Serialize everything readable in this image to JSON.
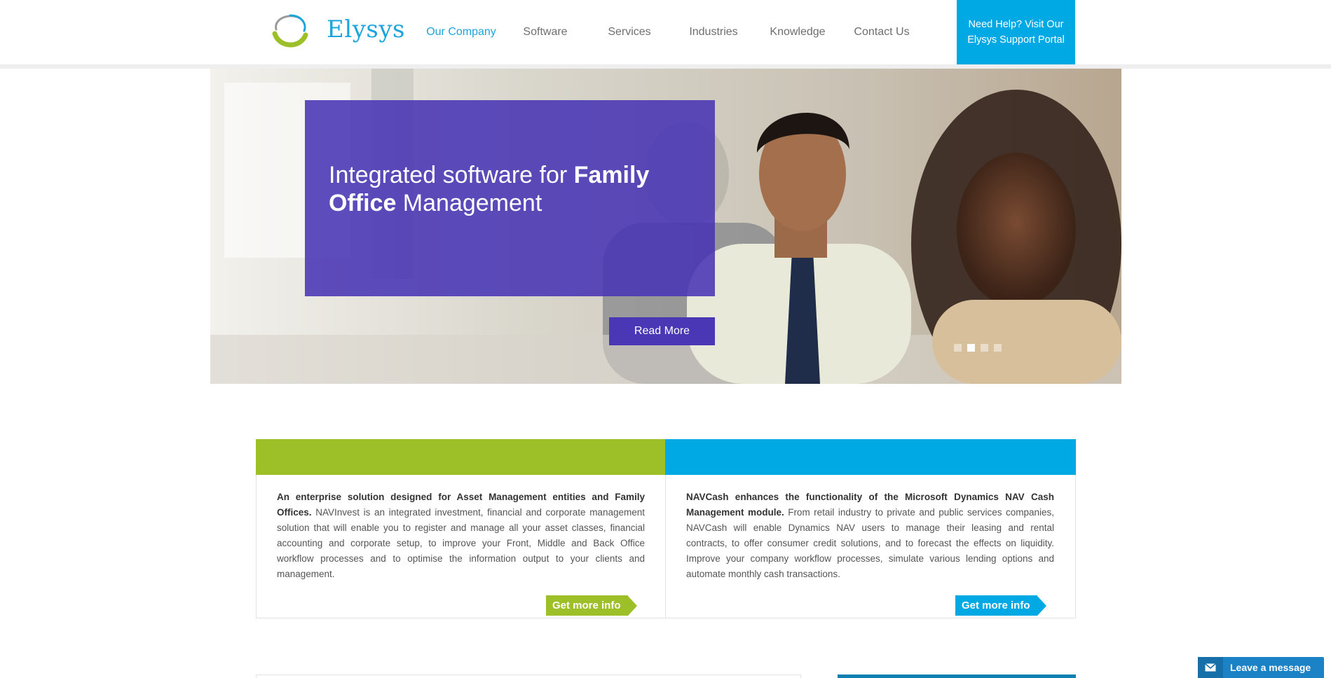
{
  "header": {
    "logo_text": "Elysys",
    "nav": [
      {
        "label": "Our Company",
        "active": true
      },
      {
        "label": "Software",
        "active": false
      },
      {
        "label": "Services",
        "active": false
      },
      {
        "label": "Industries",
        "active": false
      },
      {
        "label": "Knowledge",
        "active": false
      },
      {
        "label": "Contact Us",
        "active": false
      }
    ],
    "help_box": "Need Help? Visit Our Elysys Support Portal"
  },
  "hero": {
    "title_part1": "Integrated software for ",
    "title_bold1": "Family",
    "title_bold2": "Office",
    "title_part2": " Management",
    "read_more": "Read More",
    "slides": 4,
    "active_slide": 2
  },
  "cards": [
    {
      "bold": "An enterprise solution designed for Asset Management entities and Family Offices.",
      "text": " NAVInvest is an integrated investment, financial and corporate management solution that will enable you to register and manage all your asset classes, financial accounting and corporate setup, to improve your Front, Middle and Back Office workflow processes and to optimise the information output to your clients and management.",
      "button": "Get more info",
      "color": "#9dbf28"
    },
    {
      "bold": "NAVCash enhances the functionality of the Microsoft Dynamics NAV Cash Management module.",
      "text": " From retail industry to private and public services companies, NAVCash will enable Dynamics NAV users to manage their leasing and rental contracts, to offer consumer credit solutions, and to forecast the effects on liquidity. Improve your company workflow processes, simulate various lending options and automate monthly cash transactions.",
      "button": "Get more info",
      "color": "#00a8e4"
    }
  ],
  "chat": {
    "label": "Leave a message",
    "icon": "envelope-icon"
  },
  "colors": {
    "green": "#9dbf28",
    "blue": "#00a8e4",
    "purple": "#4a37b6"
  }
}
